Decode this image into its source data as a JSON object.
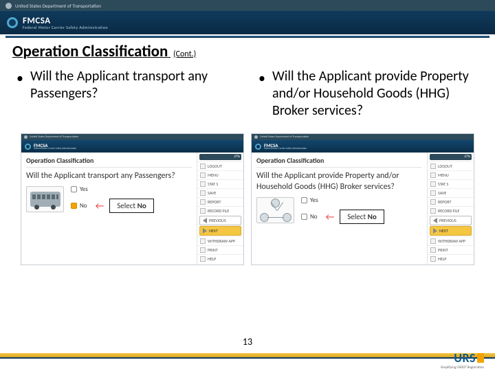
{
  "topstrip": {
    "label": "United States Department of Transportation"
  },
  "fmcsa": {
    "title": "FMCSA",
    "sub": "Federal Motor Carrier Safety Administration"
  },
  "heading": {
    "main": "Operation Classification",
    "cont": "(Cont.)"
  },
  "bullets": {
    "left": "Will the Applicant transport any Passengers?",
    "right": "Will the Applicant provide Property and/or Household Goods (HHG) Broker services?"
  },
  "shot": {
    "strip": "United States Department of Transportation",
    "brand": "FMCSA",
    "brand_sub": "Federal Motor Carrier Safety Administration",
    "section": "Operation Classification",
    "q_left": "Will the Applicant transport any Passengers?",
    "q_right": "Will the Applicant provide Property and/or Household Goods (HHG) Broker services?",
    "yes": "Yes",
    "no": "No",
    "callout_prefix": "Select ",
    "callout_bold": "No"
  },
  "side": {
    "pct": "27%",
    "items": [
      "LOGOUT",
      "MENU",
      "STAT S",
      "SAVE",
      "REPORT",
      "RECORD FILE",
      "PREVIOUS",
      "NEXT",
      "WITHDRAW APP",
      "PRINT",
      "HELP"
    ]
  },
  "page_number": "13",
  "urs": {
    "name": "URS",
    "tag": "Simplifying USDOT Registration"
  }
}
